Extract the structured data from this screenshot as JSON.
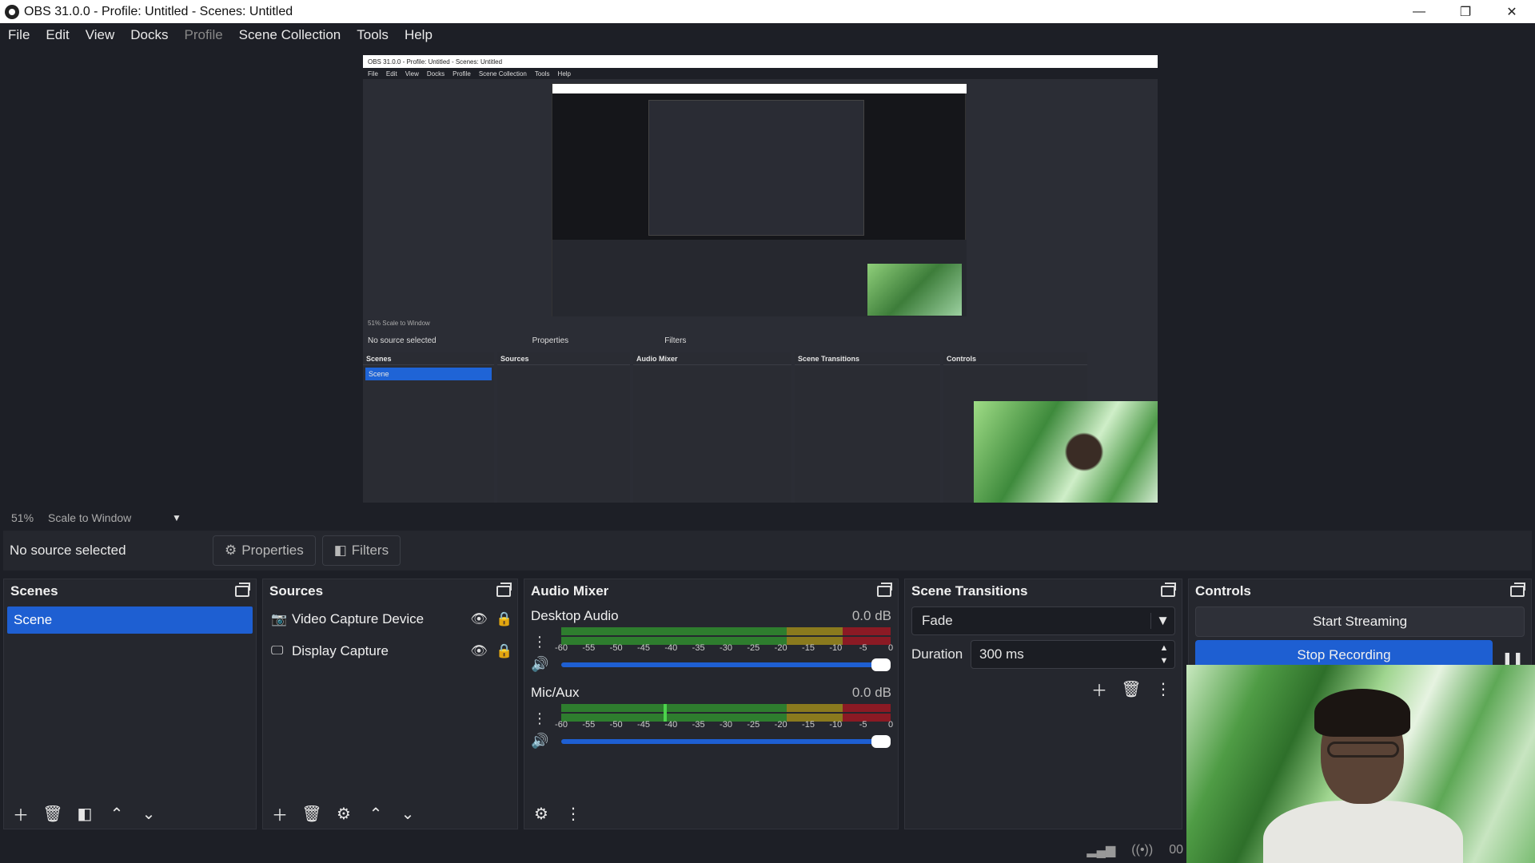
{
  "window": {
    "title": "OBS 31.0.0 - Profile: Untitled - Scenes: Untitled",
    "minimize": "—",
    "restore": "❐",
    "close": "✕"
  },
  "menu": {
    "file": "File",
    "edit": "Edit",
    "view": "View",
    "docks": "Docks",
    "profile": "Profile",
    "scene_collection": "Scene Collection",
    "tools": "Tools",
    "help": "Help"
  },
  "preview": {
    "mini_title": "OBS 31.0.0 - Profile: Untitled - Scenes: Untitled",
    "mini_menu": [
      "File",
      "Edit",
      "View",
      "Docks",
      "Profile",
      "Scene Collection",
      "Tools",
      "Help"
    ],
    "mini_status": "51%   Scale to Window",
    "mini_nosel": "No source selected",
    "mini_properties": "Properties",
    "mini_filters": "Filters",
    "mini_docks": [
      "Scenes",
      "Sources",
      "Audio Mixer",
      "Scene Transitions",
      "Controls"
    ],
    "mini_scene": "Scene"
  },
  "status": {
    "zoom": "51%",
    "scale": "Scale to Window"
  },
  "context": {
    "no_source": "No source selected",
    "properties": "Properties",
    "filters": "Filters"
  },
  "scenes": {
    "title": "Scenes",
    "items": [
      "Scene"
    ]
  },
  "sources": {
    "title": "Sources",
    "items": [
      {
        "name": "Video Capture Device",
        "icon": "camera-icon"
      },
      {
        "name": "Display Capture",
        "icon": "monitor-icon"
      }
    ]
  },
  "mixer": {
    "title": "Audio Mixer",
    "channels": [
      {
        "name": "Desktop Audio",
        "db": "0.0 dB",
        "level": 0.0
      },
      {
        "name": "Mic/Aux",
        "db": "0.0 dB",
        "level": 0.31
      }
    ],
    "ticks": [
      "-60",
      "-55",
      "-50",
      "-45",
      "-40",
      "-35",
      "-30",
      "-25",
      "-20",
      "-15",
      "-10",
      "-5",
      "0"
    ]
  },
  "transitions": {
    "title": "Scene Transitions",
    "selected": "Fade",
    "duration_label": "Duration",
    "duration_value": "300 ms"
  },
  "controls": {
    "title": "Controls",
    "start_streaming": "Start Streaming",
    "stop_recording": "Stop Recording"
  },
  "bottom": {
    "timer": "00"
  },
  "colors": {
    "accent": "#1e5fd2",
    "meter_green": "#2e8b2e",
    "meter_yellow": "#8a7a1e",
    "meter_red": "#8b1a24"
  }
}
